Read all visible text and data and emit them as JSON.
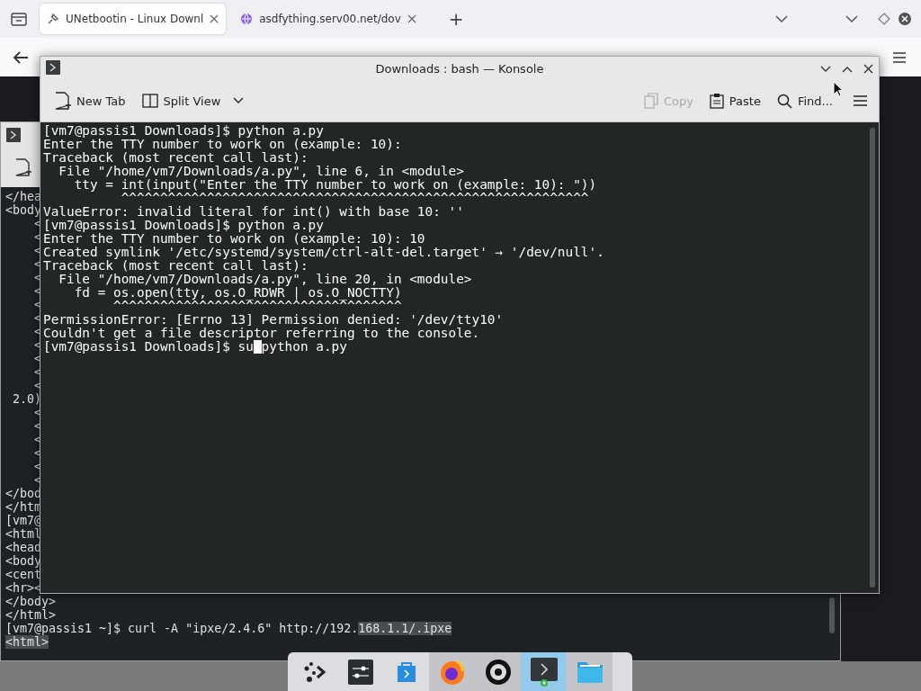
{
  "browser": {
    "tabs": [
      {
        "title": "UNetbootin - Linux Downl",
        "selected": true
      },
      {
        "title": "asdfything.serv00.net/dov",
        "selected": false
      }
    ],
    "new_tab": "+"
  },
  "background_terminal": {
    "lines": [
      [
        {
          "text": "</hea",
          "selected": false
        }
      ],
      [
        {
          "text": "<body",
          "selected": false
        }
      ],
      [
        {
          "text": "    <",
          "selected": false
        }
      ],
      [
        {
          "text": "    <",
          "selected": false
        }
      ],
      [
        {
          "text": "    <",
          "selected": false
        }
      ],
      [
        {
          "text": "    <",
          "selected": false
        }
      ],
      [
        {
          "text": "    <",
          "selected": false
        }
      ],
      [
        {
          "text": "    <",
          "selected": false
        }
      ],
      [
        {
          "text": "    <",
          "selected": false
        }
      ],
      [
        {
          "text": "    <",
          "selected": false
        }
      ],
      [
        {
          "text": "    <",
          "selected": false
        }
      ],
      [
        {
          "text": "    <",
          "selected": false
        }
      ],
      [
        {
          "text": "    <",
          "selected": false
        }
      ],
      [
        {
          "text": "    <",
          "selected": false
        }
      ],
      [
        {
          "text": "    <",
          "selected": false
        }
      ],
      [
        {
          "text": " 2.0)",
          "selected": false
        }
      ],
      [
        {
          "text": "    <",
          "selected": false
        }
      ],
      [
        {
          "text": "    <",
          "selected": false
        }
      ],
      [
        {
          "text": "    <",
          "selected": false
        }
      ],
      [
        {
          "text": "    <",
          "selected": false
        }
      ],
      [
        {
          "text": "    <",
          "selected": false
        }
      ],
      [
        {
          "text": "    <",
          "selected": false
        }
      ],
      [
        {
          "text": "</bod",
          "selected": false
        }
      ],
      [
        {
          "text": "</htm",
          "selected": false
        }
      ],
      [
        {
          "text": "[vm7@",
          "selected": false
        }
      ],
      [
        {
          "text": "<html",
          "selected": false
        }
      ],
      [
        {
          "text": "<head",
          "selected": false
        }
      ],
      [
        {
          "text": "<body",
          "selected": false
        }
      ],
      [
        {
          "text": "<cent",
          "selected": false
        }
      ],
      [
        {
          "text": "<hr><",
          "selected": false
        }
      ],
      [
        {
          "text": "</body>",
          "selected": false
        }
      ],
      [
        {
          "text": "</html>",
          "selected": false
        }
      ],
      [
        {
          "text": "[vm7@passis1 ~]$ curl -A \"ipxe/2.4.6\" http://192.",
          "selected": false
        },
        {
          "text": "168.1.1/.ipxe",
          "selected": true
        }
      ],
      [
        {
          "text": "<html>",
          "selected": true
        }
      ]
    ]
  },
  "konsole": {
    "title": "Downloads : bash — Konsole",
    "toolbar": [
      {
        "kind": "new-tab",
        "label": "New Tab",
        "disabled": false
      },
      {
        "kind": "split-view",
        "label": "Split View",
        "disabled": false
      },
      {
        "kind": "copy",
        "label": "Copy",
        "disabled": true
      },
      {
        "kind": "paste",
        "label": "Paste",
        "disabled": false
      },
      {
        "kind": "find",
        "label": "Find...",
        "disabled": false
      }
    ],
    "lines": [
      "[vm7@passis1 Downloads]$ python a.py",
      "Enter the TTY number to work on (example: 10):",
      "Traceback (most recent call last):",
      "  File \"/home/vm7/Downloads/a.py\", line 6, in <module>",
      "    tty = int(input(\"Enter the TTY number to work on (example: 10): \"))",
      "          ^^^^^^^^^^^^^^^^^^^^^^^^^^^^^^^^^^^^^^^^^^^^^^^^^^^^^^^^^^^^",
      "ValueError: invalid literal for int() with base 10: ''",
      "[vm7@passis1 Downloads]$ python a.py",
      "Enter the TTY number to work on (example: 10): 10",
      "Created symlink '/etc/systemd/system/ctrl-alt-del.target' → '/dev/null'.",
      "Traceback (most recent call last):",
      "  File \"/home/vm7/Downloads/a.py\", line 20, in <module>",
      "    fd = os.open(tty, os.O_RDWR | os.O_NOCTTY)",
      "         ^^^^^^^^^^^^^^^^^^^^^^^^^^^^^^^^^^^^^",
      "PermissionError: [Errno 13] Permission denied: '/dev/tty10'",
      "Couldn't get a file descriptor referring to the console."
    ],
    "input_line": {
      "before_cursor": "[vm7@passis1 Downloads]$ su",
      "after_cursor": "python a.py"
    }
  },
  "dock": [
    {
      "kind": "launcher",
      "running": false,
      "active": false
    },
    {
      "kind": "settings",
      "running": false,
      "active": false
    },
    {
      "kind": "store",
      "running": false,
      "active": false
    },
    {
      "kind": "browser",
      "running": true,
      "active": false
    },
    {
      "kind": "app",
      "running": true,
      "active": false
    },
    {
      "kind": "terminal",
      "running": true,
      "active": true
    },
    {
      "kind": "files",
      "running": true,
      "active": false
    }
  ]
}
